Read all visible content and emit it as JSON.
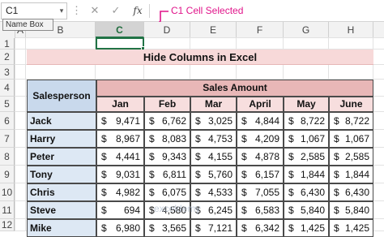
{
  "formula_bar": {
    "name_box": "C1",
    "cancel_icon": "✕",
    "enter_icon": "✓",
    "fx_label": "fx",
    "formula_value": ""
  },
  "tooltip": "Name Box",
  "annotation": {
    "label": "C1 Cell Selected",
    "color": "#e0148a"
  },
  "columns": [
    {
      "label": "A",
      "selected": false
    },
    {
      "label": "B",
      "selected": false
    },
    {
      "label": "C",
      "selected": true
    },
    {
      "label": "D",
      "selected": false
    },
    {
      "label": "E",
      "selected": false
    },
    {
      "label": "F",
      "selected": false
    },
    {
      "label": "G",
      "selected": false
    },
    {
      "label": "H",
      "selected": false
    }
  ],
  "rows": [
    "1",
    "2",
    "3",
    "4",
    "5",
    "6",
    "7",
    "8",
    "9",
    "10",
    "11",
    "12"
  ],
  "selected_cell": "C1",
  "sheet": {
    "title": "Hide Columns in Excel",
    "salesperson_header": "Salesperson",
    "sales_amount_header": "Sales Amount",
    "months": [
      "Jan",
      "Feb",
      "Mar",
      "April",
      "May",
      "June"
    ],
    "currency": "$",
    "data": [
      {
        "name": "Jack",
        "values": [
          "9,471",
          "6,762",
          "3,025",
          "4,844",
          "8,722",
          "8,722"
        ]
      },
      {
        "name": "Harry",
        "values": [
          "8,967",
          "8,083",
          "4,753",
          "4,209",
          "1,067",
          "1,067"
        ]
      },
      {
        "name": "Peter",
        "values": [
          "4,441",
          "9,343",
          "4,155",
          "4,878",
          "2,585",
          "2,585"
        ]
      },
      {
        "name": "Tony",
        "values": [
          "9,031",
          "6,811",
          "5,760",
          "6,157",
          "1,844",
          "1,844"
        ]
      },
      {
        "name": "Chris",
        "values": [
          "4,982",
          "6,075",
          "4,533",
          "7,055",
          "6,430",
          "6,430"
        ]
      },
      {
        "name": "Steve",
        "values": [
          "694",
          "4,580",
          "6,245",
          "6,583",
          "5,840",
          "5,840"
        ]
      },
      {
        "name": "Mike",
        "values": [
          "6,980",
          "3,565",
          "7,121",
          "6,342",
          "1,425",
          "1,425"
        ]
      }
    ]
  },
  "colors": {
    "accent_green": "#217346",
    "title_fill": "#f7d9d9",
    "header_blue": "#c9d9ec",
    "header_pink": "#e8b7b7"
  },
  "watermark": "exceldemy"
}
